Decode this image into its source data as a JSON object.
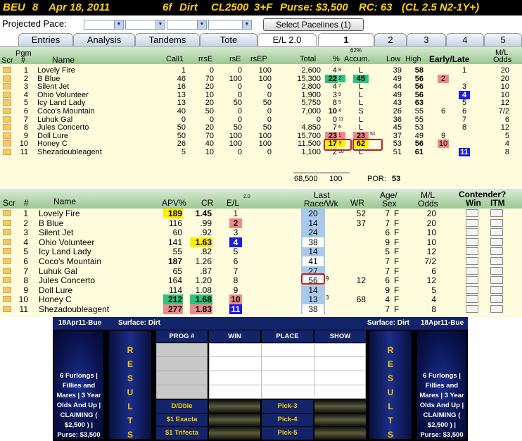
{
  "header": {
    "track": "BEU",
    "race": "8",
    "date": "Apr 18, 2011",
    "distance": "6f",
    "surface": "Dirt",
    "class": "CL2500",
    "age": "3+F",
    "purse": "Purse: $3,500",
    "rc": "RC: 63",
    "conditions": "(CL 2.5 N2-1Y+)"
  },
  "pace": {
    "label": "Projected Pace:",
    "button": "Select Pacelines  (1)"
  },
  "tabs": [
    "Entries",
    "Analysis",
    "Tandems",
    "Tote",
    "E/L 2.0",
    "1",
    "2",
    "3",
    "4",
    "5"
  ],
  "top": {
    "headers": {
      "scr": "Scr",
      "pgm": "Pgm",
      "num": "#",
      "name": "Name",
      "call1": "Call1",
      "rrse": "rrsE",
      "rse": "rsE",
      "rsep": "rsEP",
      "total": "Total",
      "pct_top": "62%",
      "pct": "%",
      "accum": "Accum.",
      "low": "Low",
      "high": "High",
      "el": "Early/Late",
      "ml_top": "M/L",
      "ml": "Odds"
    },
    "rows": [
      {
        "n": "1",
        "name": "Lovely Fire",
        "call1": "1",
        "rrse": "0",
        "rse": "0",
        "rsep": "100",
        "total": "2,600",
        "pct": "4",
        "pct_s": "8",
        "accum": "L",
        "low": "39",
        "high": "58",
        "e": "",
        "l": "1",
        "ml": "20"
      },
      {
        "n": "2",
        "name": "B Blue",
        "call1": "46",
        "rrse": "70",
        "rse": "100",
        "rsep": "100",
        "total": "15,300",
        "pct": "22",
        "pct_s": "2",
        "accum": "45",
        "low": "49",
        "high": "56",
        "e": "2",
        "l": "",
        "ml": "20"
      },
      {
        "n": "3",
        "name": "Silent Jet",
        "call1": "16",
        "rrse": "20",
        "rse": "0",
        "rsep": "0",
        "total": "2,800",
        "pct": "4",
        "pct_s": "7",
        "accum": "L",
        "low": "44",
        "high": "56",
        "e": "",
        "l": "3",
        "ml": "10"
      },
      {
        "n": "4",
        "name": "Ohio Volunteer",
        "call1": "13",
        "rrse": "10",
        "rse": "0",
        "rsep": "0",
        "total": "1,900",
        "pct": "3",
        "pct_s": "9",
        "accum": "L",
        "low": "49",
        "high": "56",
        "e": "",
        "l": "4",
        "ml": "10"
      },
      {
        "n": "5",
        "name": "Icy Land Lady",
        "call1": "13",
        "rrse": "20",
        "rse": "50",
        "rsep": "50",
        "total": "5,750",
        "pct": "8",
        "pct_s": "5",
        "accum": "L",
        "low": "43",
        "high": "63",
        "e": "",
        "l": "5",
        "ml": "12"
      },
      {
        "n": "6",
        "name": "Coco's Mountain",
        "call1": "40",
        "rrse": "50",
        "rse": "0",
        "rsep": "0",
        "total": "7,000",
        "pct": "10",
        "pct_s": "4",
        "accum": "S",
        "low": "26",
        "high": "55",
        "e": "6",
        "l": "6",
        "ml": "7/2"
      },
      {
        "n": "7",
        "name": "Luhuk Gal",
        "call1": "0",
        "rrse": "0",
        "rse": "0",
        "rsep": "0",
        "total": "0",
        "pct": "0",
        "pct_s": "11",
        "accum": "L",
        "low": "36",
        "high": "55",
        "e": "",
        "l": "7",
        "ml": "6"
      },
      {
        "n": "8",
        "name": "Jules Concerto",
        "call1": "50",
        "rrse": "20",
        "rse": "50",
        "rsep": "50",
        "total": "4,850",
        "pct": "7",
        "pct_s": "6",
        "accum": "L",
        "low": "45",
        "high": "53",
        "e": "",
        "l": "8",
        "ml": "12"
      },
      {
        "n": "9",
        "name": "Doll Lure",
        "call1": "50",
        "rrse": "70",
        "rse": "100",
        "rsep": "100",
        "total": "15,700",
        "pct": "23",
        "pct_s": "1",
        "accum": "23",
        "accum_s": "51",
        "low": "37",
        "high": "49",
        "e": "9",
        "l": "",
        "ml": "5"
      },
      {
        "n": "10",
        "name": "Honey C",
        "call1": "26",
        "rrse": "40",
        "rse": "100",
        "rsep": "100",
        "total": "11,500",
        "pct": "17",
        "pct_s": "3",
        "accum": "62",
        "low": "53",
        "high": "56",
        "e": "10",
        "l": "",
        "ml": "4"
      },
      {
        "n": "11",
        "name": "Shezadoubleagent",
        "call1": "5",
        "rrse": "10",
        "rse": "0",
        "rsep": "0",
        "total": "1,100",
        "pct": "2",
        "pct_s": "10",
        "accum": "L",
        "low": "51",
        "high": "61",
        "e": "",
        "l": "11",
        "ml": "8"
      }
    ],
    "totals": {
      "total": "68,500",
      "pct": "100",
      "por_label": "POR:",
      "por": "53"
    }
  },
  "bottom": {
    "headers": {
      "scr": "Scr",
      "num": "#",
      "name": "Name",
      "apv": "APV%",
      "cr": "CR",
      "el": "E/L",
      "el_sup": "2.0",
      "last_top": "Last",
      "last": "Race/Wk",
      "wr": "WR",
      "age_top": "Age/",
      "age": "Sex",
      "ml_top": "M/L",
      "ml": "Odds",
      "cont": "Contender?",
      "win": "Win",
      "itm": "ITM"
    },
    "rows": [
      {
        "n": "1",
        "name": "Lovely Fire",
        "apv": "189",
        "cr": "1.45",
        "el": "1",
        "last": "20",
        "last_s": "",
        "wr": "52",
        "age": "7",
        "sex": "F",
        "ml": "20"
      },
      {
        "n": "2",
        "name": "B Blue",
        "apv": "116",
        "cr": ".99",
        "el": "2",
        "last": "14",
        "last_s": "",
        "wr": "37",
        "age": "7",
        "sex": "F",
        "ml": "20"
      },
      {
        "n": "3",
        "name": "Silent Jet",
        "apv": "60",
        "cr": ".92",
        "el": "3",
        "last": "24",
        "last_s": "",
        "wr": "",
        "age": "6",
        "sex": "F",
        "ml": "10"
      },
      {
        "n": "4",
        "name": "Ohio Volunteer",
        "apv": "141",
        "cr": "1.63",
        "el": "4",
        "last": "38",
        "last_s": "",
        "wr": "",
        "age": "9",
        "sex": "F",
        "ml": "10"
      },
      {
        "n": "5",
        "name": "Icy Land Lady",
        "apv": "55",
        "cr": ".82",
        "el": "5",
        "last": "14",
        "last_s": "",
        "wr": "",
        "age": "5",
        "sex": "F",
        "ml": "12"
      },
      {
        "n": "6",
        "name": "Coco's Mountain",
        "apv": "187",
        "cr": "1.26",
        "el": "6",
        "last": "41",
        "last_s": "",
        "wr": "",
        "age": "7",
        "sex": "F",
        "ml": "7/2"
      },
      {
        "n": "7",
        "name": "Luhuk Gal",
        "apv": "65",
        "cr": ".87",
        "el": "7",
        "last": "27",
        "last_s": "",
        "wr": "",
        "age": "7",
        "sex": "F",
        "ml": "6"
      },
      {
        "n": "8",
        "name": "Jules Concerto",
        "apv": "164",
        "cr": "1.20",
        "el": "8",
        "last": "56",
        "last_s": "9",
        "wr": "12",
        "age": "6",
        "sex": "F",
        "ml": "12"
      },
      {
        "n": "9",
        "name": "Doll Lure",
        "apv": "114",
        "cr": "1.08",
        "el": "9",
        "last": "14",
        "last_s": "",
        "wr": "",
        "age": "9",
        "sex": "F",
        "ml": "5"
      },
      {
        "n": "10",
        "name": "Honey C",
        "apv": "212",
        "cr": "1.68",
        "el": "10",
        "last": "13",
        "last_s": "3",
        "wr": "68",
        "age": "4",
        "sex": "F",
        "ml": "4"
      },
      {
        "n": "11",
        "name": "Shezadoubleagent",
        "apv": "277",
        "cr": "1.83",
        "el": "11",
        "last": "38",
        "last_s": "",
        "wr": "",
        "age": "7",
        "sex": "F",
        "ml": "8"
      }
    ]
  },
  "results": {
    "bar_left": "18Apr11-Bue",
    "bar_surface": "Surface: Dirt",
    "bar_surface2": "Surface: Dirt",
    "bar_right": "18Apr11-Bue",
    "side_left": [
      "6 Furlongs |",
      "Fillies and",
      "Mares | 3 Year",
      "Olds And Up |",
      "CLAIMING (",
      "$2,500 ) |",
      "Purse: $3,500"
    ],
    "side_right": [
      "6 Furlongs |",
      "Fillies and",
      "Mares | 3 Year",
      "Olds And Up |",
      "CLAIMING (",
      "$2,500 ) |",
      "Purse: $3,500"
    ],
    "results_letters": [
      "R",
      "E",
      "S",
      "U",
      "L",
      "T",
      "S"
    ],
    "cols": [
      "PROG #",
      "WIN",
      "PLACE",
      "SHOW"
    ],
    "exotics_left": [
      "D/Dble",
      "$1 Exacta",
      "$1 Trifecta"
    ],
    "exotics_mid": [
      "Pick-3",
      "Pick-4",
      "Pick-5"
    ]
  }
}
